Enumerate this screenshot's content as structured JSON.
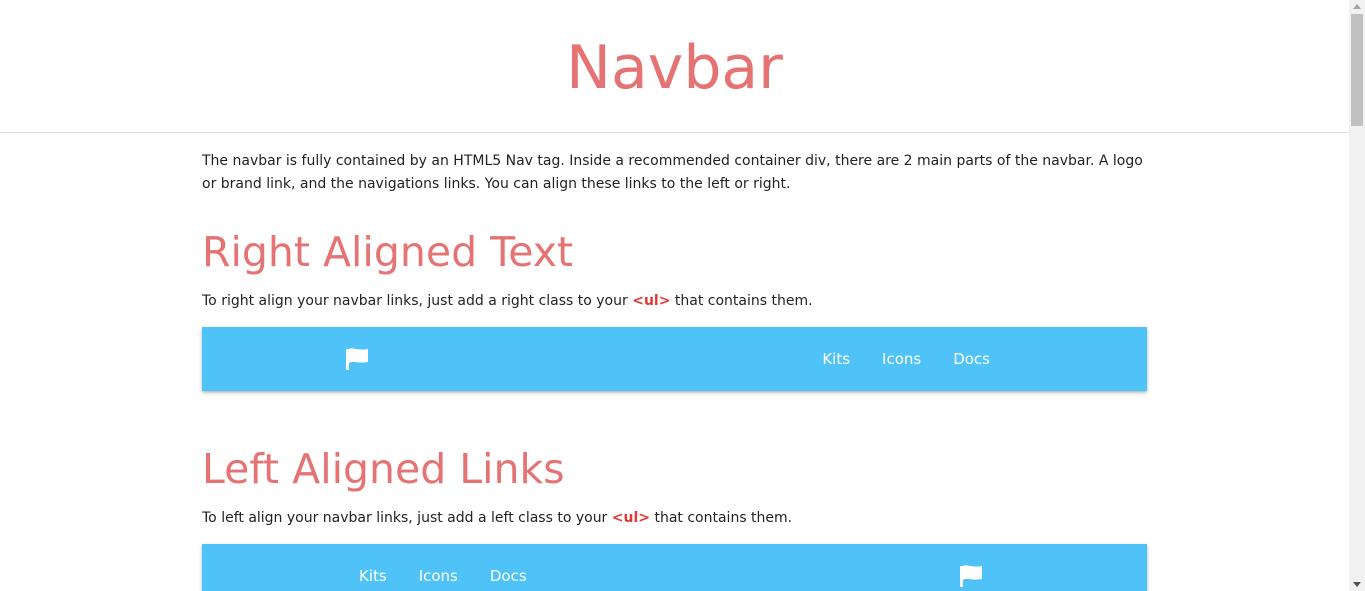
{
  "header": {
    "title": "Navbar"
  },
  "intro": {
    "text": "The navbar is fully contained by an HTML5 Nav tag. Inside a recommended container div, there are 2 main parts of the navbar. A logo or brand link, and the navigations links. You can align these links to the left or right."
  },
  "right_aligned": {
    "title": "Right Aligned Text",
    "desc_before": "To right align your navbar links, just add a right class to your ",
    "code": "<ul>",
    "desc_after": " that contains them.",
    "nav": {
      "logo_icon": "flag-icon",
      "links": [
        "Kits",
        "Icons",
        "Docs"
      ]
    }
  },
  "left_aligned": {
    "title": "Left Aligned Links",
    "desc_before": "To left align your navbar links, just add a left class to your ",
    "code": "<ul>",
    "desc_after": " that contains them.",
    "nav": {
      "logo_icon": "flag-icon",
      "links": [
        "Kits",
        "Icons",
        "Docs"
      ]
    }
  },
  "colors": {
    "accent": "#e57373",
    "navbar": "#4fc3f7",
    "code": "#e53935"
  }
}
